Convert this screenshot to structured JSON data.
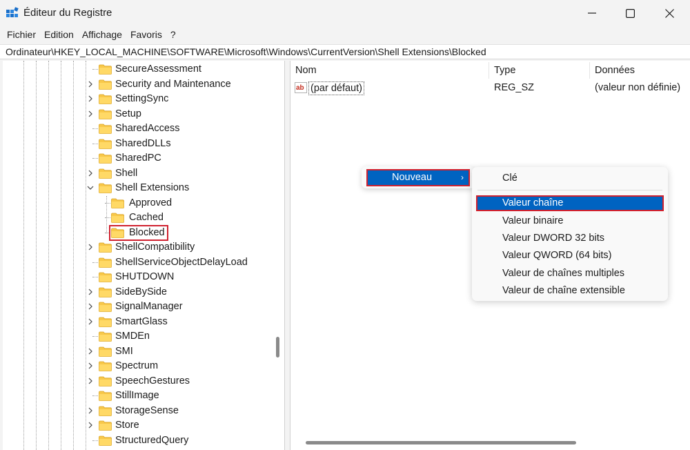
{
  "window": {
    "title": "Éditeur du Registre",
    "accent": "#0063c1",
    "highlight_border": "#d0202e"
  },
  "menu": [
    "Fichier",
    "Edition",
    "Affichage",
    "Favoris",
    "?"
  ],
  "address": "Ordinateur\\HKEY_LOCAL_MACHINE\\SOFTWARE\\Microsoft\\Windows\\CurrentVersion\\Shell Extensions\\Blocked",
  "tree": [
    {
      "label": "SecureAssessment",
      "level": 0,
      "expandable": false
    },
    {
      "label": "Security and Maintenance",
      "level": 0,
      "expandable": true
    },
    {
      "label": "SettingSync",
      "level": 0,
      "expandable": true
    },
    {
      "label": "Setup",
      "level": 0,
      "expandable": true
    },
    {
      "label": "SharedAccess",
      "level": 0,
      "expandable": false
    },
    {
      "label": "SharedDLLs",
      "level": 0,
      "expandable": false
    },
    {
      "label": "SharedPC",
      "level": 0,
      "expandable": false
    },
    {
      "label": "Shell",
      "level": 0,
      "expandable": true
    },
    {
      "label": "Shell Extensions",
      "level": 0,
      "expandable": true,
      "expanded": true
    },
    {
      "label": "Approved",
      "level": 1,
      "expandable": false
    },
    {
      "label": "Cached",
      "level": 1,
      "expandable": false
    },
    {
      "label": "Blocked",
      "level": 1,
      "expandable": false,
      "selected": true
    },
    {
      "label": "ShellCompatibility",
      "level": 0,
      "expandable": true
    },
    {
      "label": "ShellServiceObjectDelayLoad",
      "level": 0,
      "expandable": false
    },
    {
      "label": "SHUTDOWN",
      "level": 0,
      "expandable": false
    },
    {
      "label": "SideBySide",
      "level": 0,
      "expandable": true
    },
    {
      "label": "SignalManager",
      "level": 0,
      "expandable": true
    },
    {
      "label": "SmartGlass",
      "level": 0,
      "expandable": true
    },
    {
      "label": "SMDEn",
      "level": 0,
      "expandable": false
    },
    {
      "label": "SMI",
      "level": 0,
      "expandable": true
    },
    {
      "label": "Spectrum",
      "level": 0,
      "expandable": true
    },
    {
      "label": "SpeechGestures",
      "level": 0,
      "expandable": true
    },
    {
      "label": "StillImage",
      "level": 0,
      "expandable": false
    },
    {
      "label": "StorageSense",
      "level": 0,
      "expandable": true
    },
    {
      "label": "Store",
      "level": 0,
      "expandable": true
    },
    {
      "label": "StructuredQuery",
      "level": 0,
      "expandable": false
    }
  ],
  "columns": {
    "name": "Nom",
    "type": "Type",
    "data": "Données"
  },
  "values": [
    {
      "name": "(par défaut)",
      "type": "REG_SZ",
      "data": "(valeur non définie)",
      "icon": "string-value-icon"
    }
  ],
  "context_menu": {
    "new_label": "Nouveau",
    "arrow": "›",
    "submenu": [
      "Clé",
      "Valeur chaîne",
      "Valeur binaire",
      "Valeur DWORD 32 bits",
      "Valeur QWORD (64 bits)",
      "Valeur de chaînes multiples",
      "Valeur de chaîne extensible"
    ],
    "highlighted": "Valeur chaîne"
  }
}
